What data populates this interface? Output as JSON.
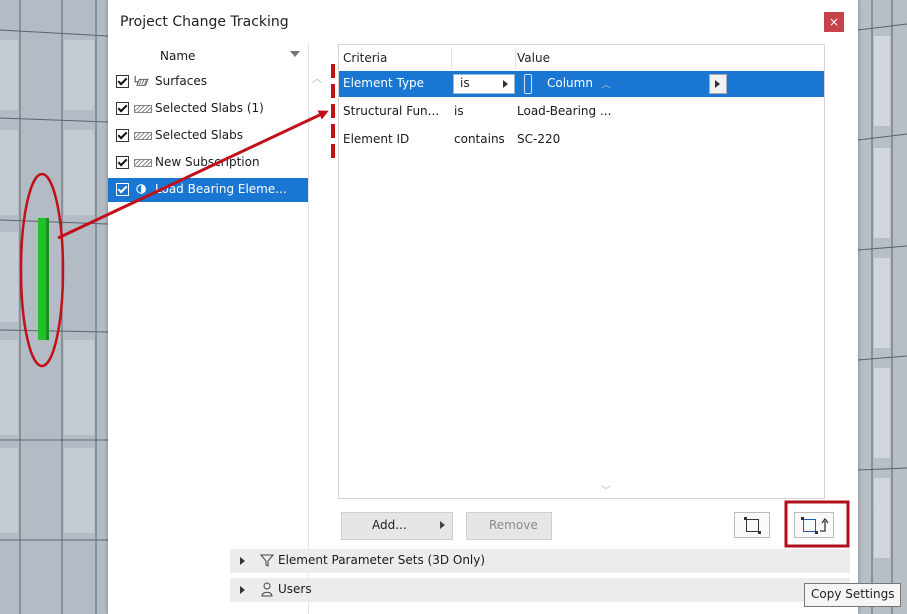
{
  "window": {
    "title": "Project Change Tracking",
    "close_glyph": "×"
  },
  "subscriptions": {
    "header": "Name",
    "items": [
      {
        "label": "Surfaces",
        "icon": "surfaces-icon",
        "checked": true,
        "selected": false
      },
      {
        "label": "Selected Slabs (1)",
        "icon": "slab-icon",
        "checked": true,
        "selected": false
      },
      {
        "label": "Selected Slabs",
        "icon": "slab-icon",
        "checked": true,
        "selected": false
      },
      {
        "label": "New Subscription",
        "icon": "slab-icon",
        "checked": true,
        "selected": false
      },
      {
        "label": "Load Bearing Eleme...",
        "icon": "criteria-icon",
        "checked": true,
        "selected": true
      }
    ]
  },
  "criteria": {
    "headers": {
      "criteria": "Criteria",
      "value": "Value"
    },
    "rows": [
      {
        "criteria": "Element Type",
        "operator": "is",
        "value": "Column",
        "selected": true
      },
      {
        "criteria": "Structural Fun...",
        "operator": "is",
        "value": "Load-Bearing ...",
        "selected": false
      },
      {
        "criteria": "Element ID",
        "operator": "contains",
        "value": "SC-220",
        "selected": false
      }
    ]
  },
  "buttons": {
    "add": "Add...",
    "remove": "Remove"
  },
  "sections": {
    "parameter_sets": "Element Parameter Sets (3D Only)",
    "users": "Users"
  },
  "tooltip": "Copy Settings",
  "colors": {
    "selection": "#1976d2",
    "annotation": "#c0101a",
    "highlight_element": "#22c02a"
  }
}
